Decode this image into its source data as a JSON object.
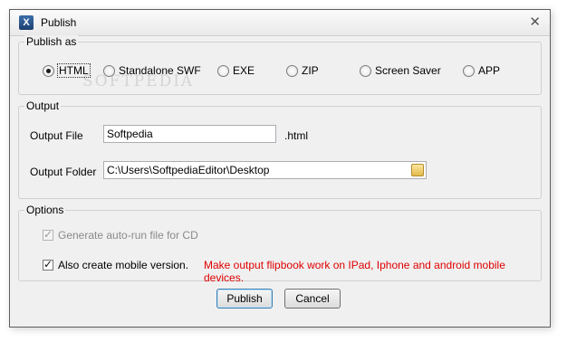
{
  "window": {
    "title": "Publish",
    "app_icon": "X",
    "close_glyph": "✕"
  },
  "watermark": "SOFTPEDIA",
  "publish_as": {
    "legend": "Publish as",
    "options": [
      "HTML",
      "Standalone SWF",
      "EXE",
      "ZIP",
      "Screen Saver",
      "APP"
    ],
    "selected": "HTML"
  },
  "output": {
    "legend": "Output",
    "file_label": "Output File",
    "file_value": "Softpedia",
    "file_ext": ".html",
    "folder_label": "Output Folder",
    "folder_value": "C:\\Users\\SoftpediaEditor\\Desktop"
  },
  "options": {
    "legend": "Options",
    "autorun_label": "Generate auto-run file for CD",
    "autorun_checked": true,
    "autorun_disabled": true,
    "mobile_label": "Also create mobile version.",
    "mobile_checked": true,
    "mobile_note": "Make output flipbook work on IPad, Iphone and android mobile devices."
  },
  "buttons": {
    "publish": "Publish",
    "cancel": "Cancel"
  },
  "icons": {
    "app": "app-logo-icon",
    "close": "close-icon",
    "folder": "folder-icon"
  }
}
